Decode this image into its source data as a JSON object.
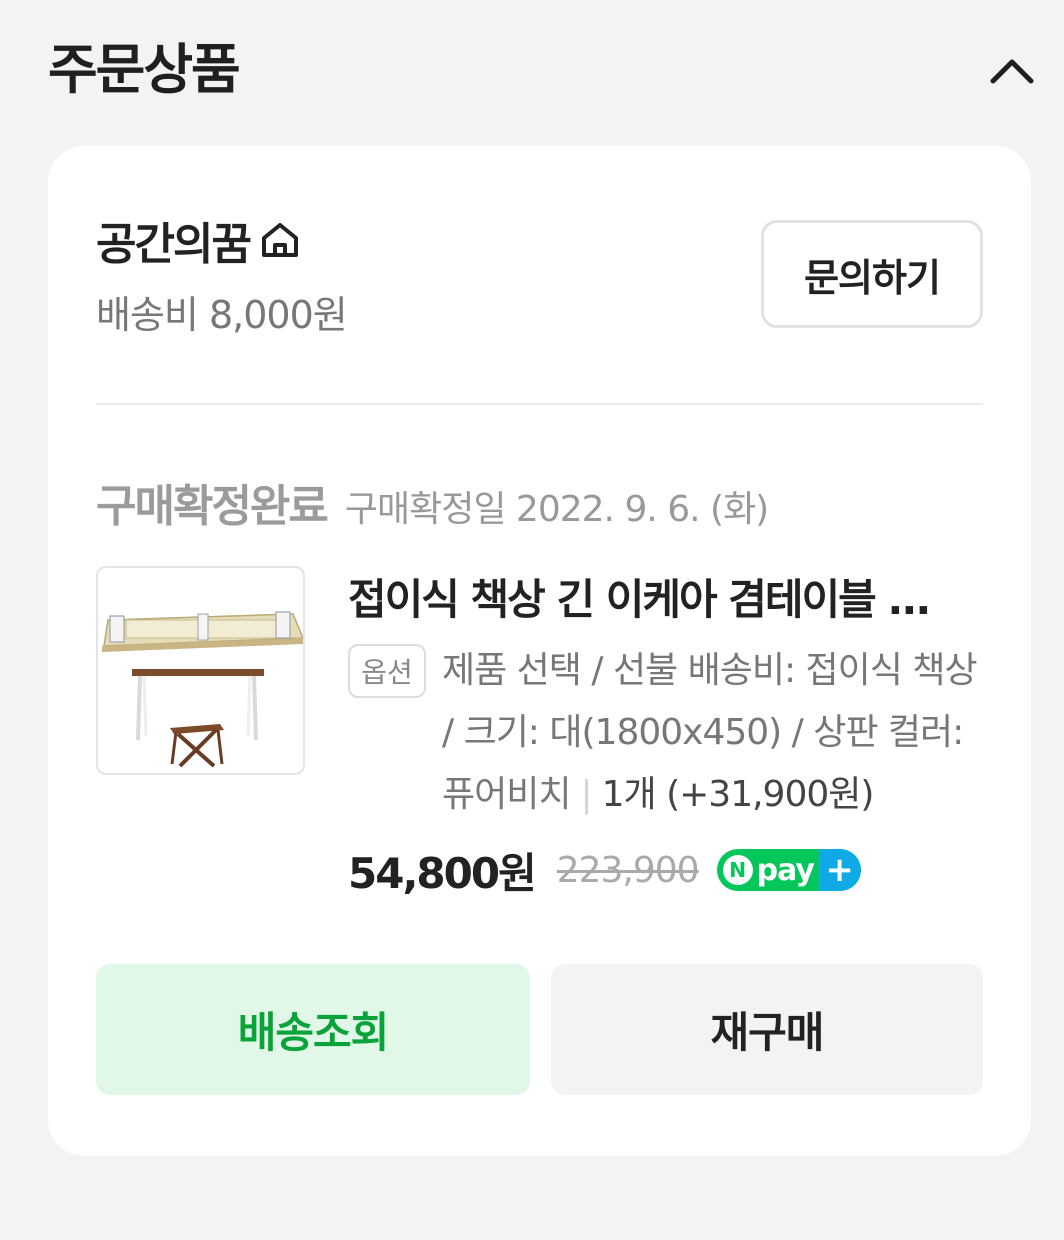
{
  "section": {
    "title": "주문상품"
  },
  "seller": {
    "name": "공간의꿈",
    "shipping_fee": "배송비 8,000원",
    "inquiry_label": "문의하기"
  },
  "order": {
    "status": "구매확정완료",
    "status_date": "구매확정일 2022. 9. 6. (화)"
  },
  "product": {
    "name": "접이식 책상 긴 이케아 겸테이블 ...",
    "option_badge": "옵션",
    "option_text": "제품 선택 / 선불 배송비: 접이식 책상 / 크기: 대(1800x450) / 상판 컬러: 퓨어비치",
    "quantity": "1개 (+31,900원)",
    "price": "54,800원",
    "original_price": "223,900",
    "npay_label": "pay"
  },
  "actions": {
    "track_label": "배송조회",
    "rebuy_label": "재구매"
  },
  "colors": {
    "accent_green": "#0aa33a",
    "track_button_bg": "#e1f8e8",
    "npay_green": "#03c75a",
    "npay_blue": "#0fa9e6"
  }
}
